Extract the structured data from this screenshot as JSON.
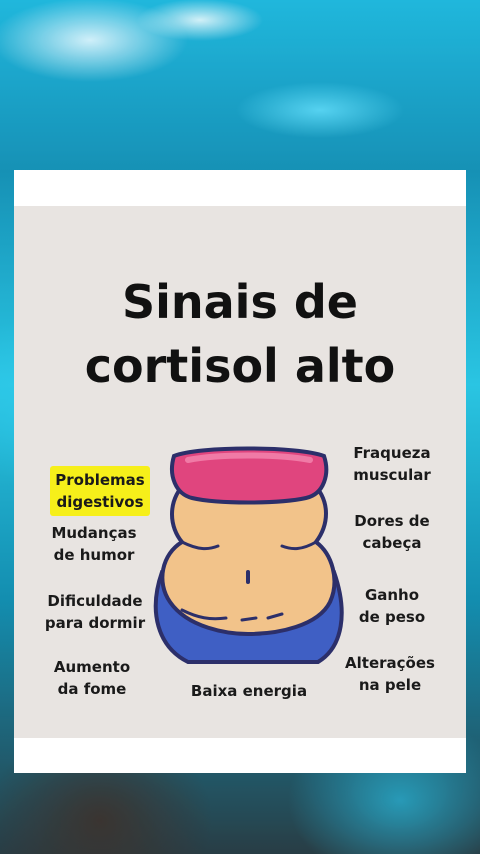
{
  "title_lines": [
    "Sinais de",
    "cortisol alto"
  ],
  "signs": {
    "problemas": "Problemas\ndigestivos",
    "humor": "Mudanças\nde humor",
    "dormir": "Dificuldade\npara dormir",
    "fome": "Aumento\nda fome",
    "energia": "Baixa energia",
    "fraqueza": "Fraqueza\nmuscular",
    "cabeca": "Dores de\ncabeça",
    "peso": "Ganho\nde peso",
    "pele": "Alterações\nna pele"
  },
  "colors": {
    "highlight": "#f6ef1a",
    "skin": "#f2c38a",
    "top": "#e0457e",
    "pants": "#3f5fc4",
    "outline": "#2c2f6a"
  },
  "icon": "belly-illustration"
}
